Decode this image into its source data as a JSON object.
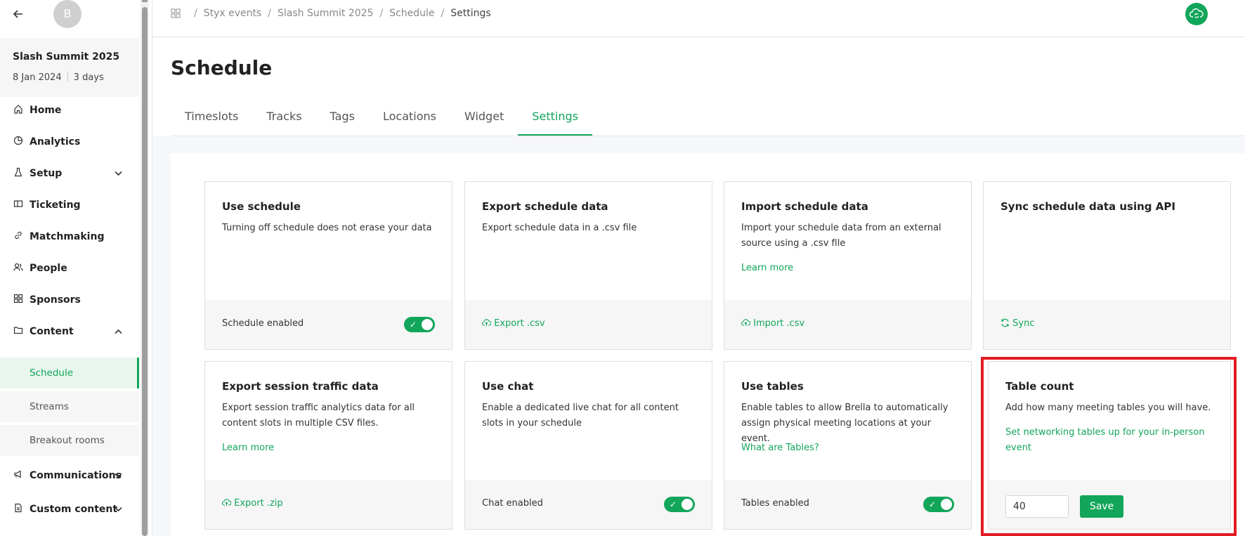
{
  "sidebar": {
    "avatar_initial": "B",
    "event_name": "Slash Summit 2025",
    "event_date": "8 Jan 2024",
    "event_duration": "3 days",
    "items": [
      {
        "label": "Home",
        "icon": "home-icon"
      },
      {
        "label": "Analytics",
        "icon": "pie-chart-icon"
      },
      {
        "label": "Setup",
        "icon": "flask-icon"
      },
      {
        "label": "Ticketing",
        "icon": "ticket-icon"
      },
      {
        "label": "Matchmaking",
        "icon": "link-icon"
      },
      {
        "label": "People",
        "icon": "people-icon"
      },
      {
        "label": "Sponsors",
        "icon": "grid-icon"
      },
      {
        "label": "Content",
        "icon": "folder-icon"
      },
      {
        "label": "Communications",
        "icon": "megaphone-icon"
      },
      {
        "label": "Custom content",
        "icon": "document-icon"
      }
    ],
    "content_sub": [
      {
        "label": "Schedule"
      },
      {
        "label": "Streams"
      },
      {
        "label": "Breakout rooms"
      }
    ]
  },
  "breadcrumb": [
    "Styx events",
    "Slash Summit 2025",
    "Schedule",
    "Settings"
  ],
  "page_title": "Schedule",
  "tabs": [
    "Timeslots",
    "Tracks",
    "Tags",
    "Locations",
    "Widget",
    "Settings"
  ],
  "active_tab": "Settings",
  "cards": {
    "use_schedule": {
      "title": "Use schedule",
      "desc": "Turning off schedule does not erase your data",
      "footer": "Schedule enabled"
    },
    "export_schedule": {
      "title": "Export schedule data",
      "desc": "Export schedule data in a .csv file",
      "footer": "Export .csv"
    },
    "import_schedule": {
      "title": "Import schedule data",
      "desc": "Import your schedule data from an external source using a .csv file",
      "link": "Learn more",
      "footer": "Import .csv"
    },
    "sync_schedule": {
      "title": "Sync schedule data using API",
      "footer": "Sync"
    },
    "export_traffic": {
      "title": "Export session traffic data",
      "desc": "Export session traffic analytics data for all content slots in multiple CSV files.",
      "link": "Learn more",
      "footer": "Export .zip"
    },
    "use_chat": {
      "title": "Use chat",
      "desc": "Enable a dedicated live chat for all content slots in your schedule",
      "footer": "Chat enabled"
    },
    "use_tables": {
      "title": "Use tables",
      "desc": "Enable tables to allow Brella to automatically assign physical meeting locations at your event.",
      "link": "What are Tables?",
      "footer": "Tables enabled"
    },
    "table_count": {
      "title": "Table count",
      "desc": "Add how many meeting tables you will have.",
      "link": "Set networking tables up for your in-person event",
      "value": "40",
      "save": "Save"
    }
  },
  "colors": {
    "accent": "#12a65a",
    "highlight": "#e31b23"
  }
}
